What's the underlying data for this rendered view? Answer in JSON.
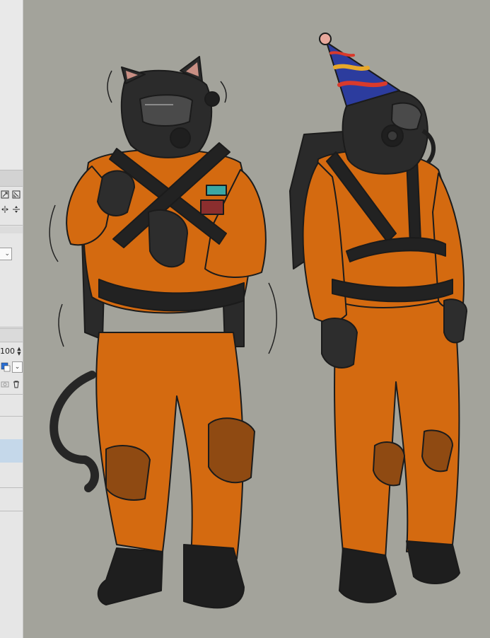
{
  "left_panel": {
    "opacity_value": "100",
    "icons": [
      "resize-icon",
      "fit-icon",
      "flip-horizontal-icon",
      "flip-vertical-icon",
      "dropdown-chevron-icon",
      "spin-up-icon",
      "spin-down-icon",
      "color-swatch-icon",
      "camera-icon",
      "trash-icon"
    ]
  },
  "colors": {
    "canvas_background": "#a3a39b",
    "suit_orange": "#d46a10",
    "gear_black": "#2b2b2b",
    "panel_bg": "#e6e6e6",
    "panel_highlight": "#c5d8ea"
  },
  "canvas": {
    "characters": [
      "cat-ears-suited-figure",
      "party-hat-suited-figure"
    ]
  }
}
